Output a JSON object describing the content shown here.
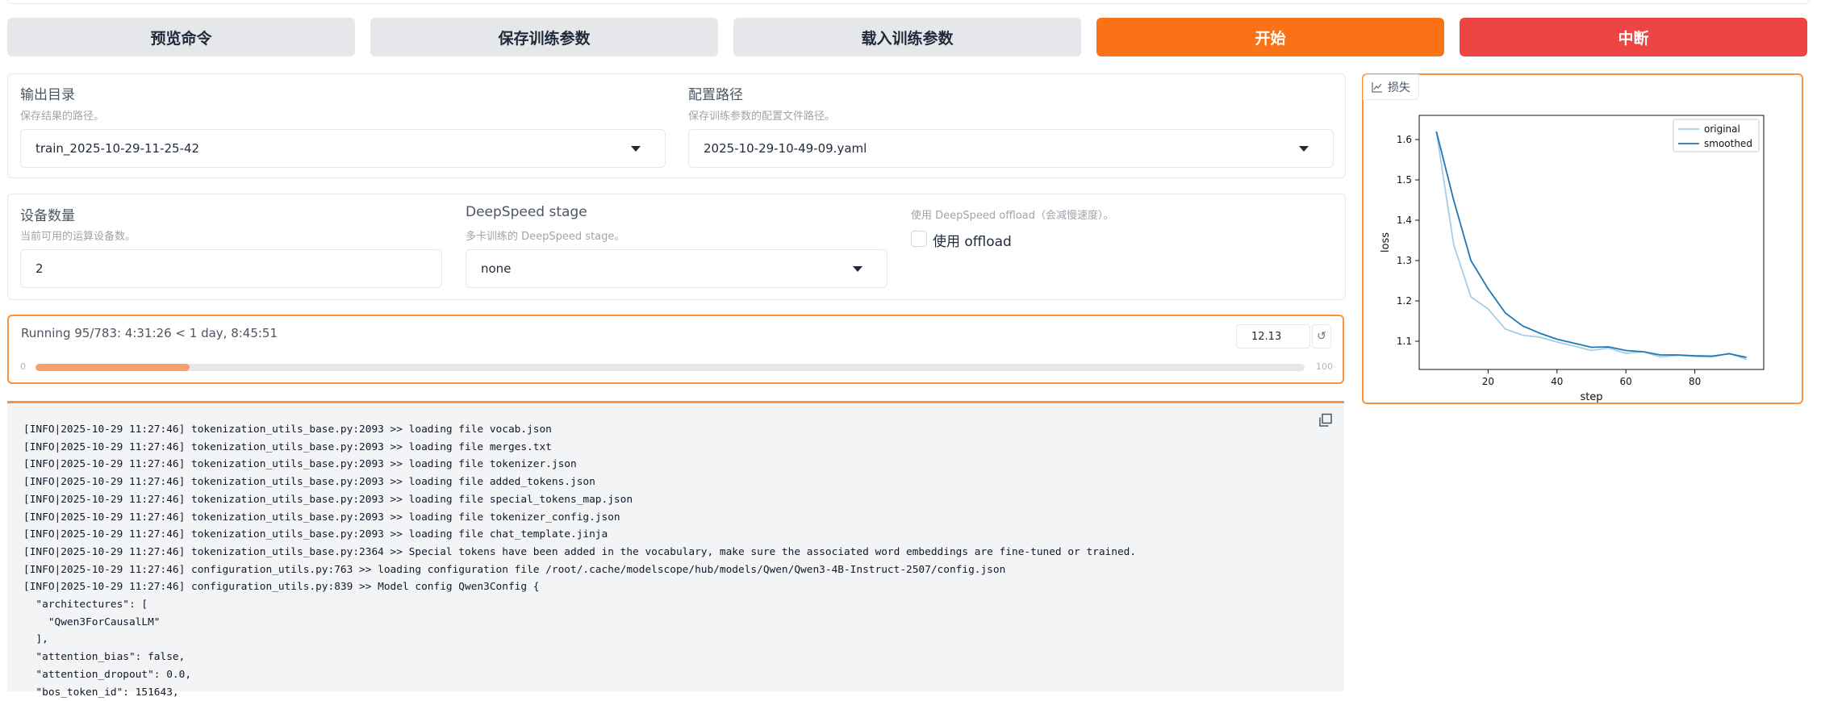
{
  "toolbar": {
    "preview_label": "预览命令",
    "save_label": "保存训练参数",
    "load_label": "载入训练参数",
    "start_label": "开始",
    "abort_label": "中断"
  },
  "output_dir": {
    "label": "输出目录",
    "info": "保存结果的路径。",
    "value": "train_2025-10-29-11-25-42"
  },
  "config_path": {
    "label": "配置路径",
    "info": "保存训练参数的配置文件路径。",
    "value": "2025-10-29-10-49-09.yaml"
  },
  "device_count": {
    "label": "设备数量",
    "info": "当前可用的运算设备数。",
    "value": "2"
  },
  "ds_stage": {
    "label": "DeepSpeed stage",
    "info": "多卡训练的 DeepSpeed stage。",
    "value": "none"
  },
  "ds_offload": {
    "info": "使用 DeepSpeed offload（会减慢速度）。",
    "label": "使用 offload",
    "checked": false
  },
  "progress": {
    "status": "Running 95/783: 4:31:26 < 1 day, 8:45:51",
    "value": 12.13,
    "value_text": "12.13",
    "min": "0",
    "max": "100"
  },
  "log_lines": [
    "[INFO|2025-10-29 11:27:46] tokenization_utils_base.py:2093 >> loading file vocab.json",
    "[INFO|2025-10-29 11:27:46] tokenization_utils_base.py:2093 >> loading file merges.txt",
    "[INFO|2025-10-29 11:27:46] tokenization_utils_base.py:2093 >> loading file tokenizer.json",
    "[INFO|2025-10-29 11:27:46] tokenization_utils_base.py:2093 >> loading file added_tokens.json",
    "[INFO|2025-10-29 11:27:46] tokenization_utils_base.py:2093 >> loading file special_tokens_map.json",
    "[INFO|2025-10-29 11:27:46] tokenization_utils_base.py:2093 >> loading file tokenizer_config.json",
    "[INFO|2025-10-29 11:27:46] tokenization_utils_base.py:2093 >> loading file chat_template.jinja",
    "[INFO|2025-10-29 11:27:46] tokenization_utils_base.py:2364 >> Special tokens have been added in the vocabulary, make sure the associated word embeddings are fine-tuned or trained.",
    "[INFO|2025-10-29 11:27:46] configuration_utils.py:763 >> loading configuration file /root/.cache/modelscope/hub/models/Qwen/Qwen3-4B-Instruct-2507/config.json",
    "[INFO|2025-10-29 11:27:46] configuration_utils.py:839 >> Model config Qwen3Config {",
    "  \"architectures\": [",
    "    \"Qwen3ForCausalLM\"",
    "  ],",
    "  \"attention_bias\": false,",
    "  \"attention_dropout\": 0.0,",
    "  \"bos_token_id\": 151643,"
  ],
  "plot_label": "损失",
  "chart_data": {
    "type": "line",
    "xlabel": "step",
    "ylabel": "loss",
    "xlim": [
      0,
      100
    ],
    "ylim": [
      1.03,
      1.66
    ],
    "xticks": [
      20,
      40,
      60,
      80
    ],
    "yticks": [
      1.1,
      1.2,
      1.3,
      1.4,
      1.5,
      1.6
    ],
    "legend": "top-right",
    "series": [
      {
        "name": "original",
        "color": "#a6cee3",
        "x": [
          5,
          10,
          15,
          20,
          25,
          30,
          35,
          40,
          45,
          50,
          55,
          60,
          65,
          70,
          75,
          80,
          85,
          90,
          95
        ],
        "y": [
          1.62,
          1.34,
          1.21,
          1.18,
          1.13,
          1.115,
          1.11,
          1.098,
          1.088,
          1.077,
          1.083,
          1.07,
          1.074,
          1.061,
          1.065,
          1.062,
          1.061,
          1.07,
          1.055
        ]
      },
      {
        "name": "smoothed",
        "color": "#1f78b4",
        "x": [
          5,
          10,
          15,
          20,
          25,
          30,
          35,
          40,
          45,
          50,
          55,
          60,
          65,
          70,
          75,
          80,
          85,
          90,
          95
        ],
        "y": [
          1.62,
          1.45,
          1.3,
          1.23,
          1.17,
          1.138,
          1.12,
          1.105,
          1.095,
          1.085,
          1.086,
          1.077,
          1.074,
          1.066,
          1.066,
          1.064,
          1.063,
          1.069,
          1.06
        ]
      }
    ]
  }
}
